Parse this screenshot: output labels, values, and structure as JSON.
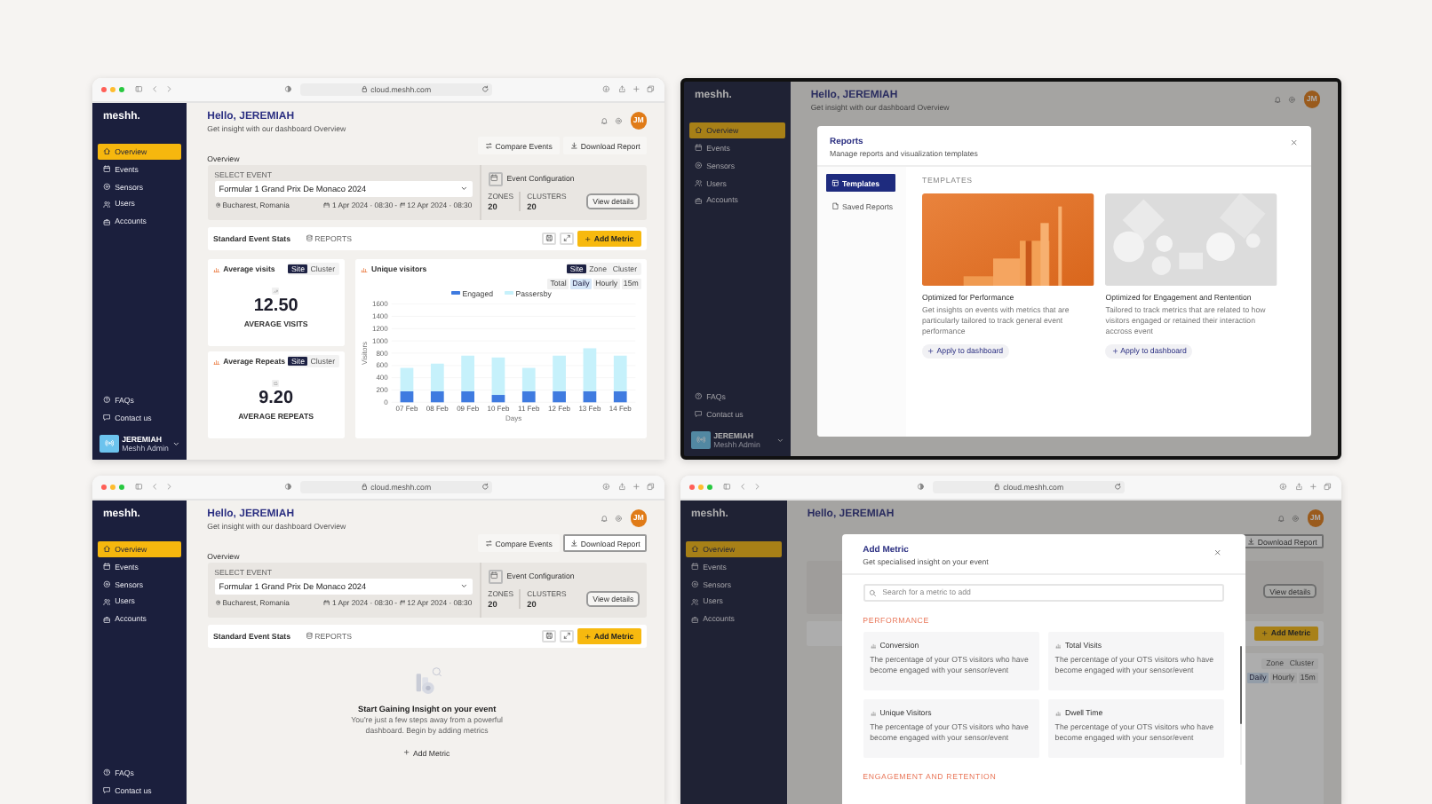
{
  "screens": [
    {
      "browser": {
        "url": "cloud.meshh.com"
      },
      "sidebar": {
        "logo": "meshh.",
        "items": [
          {
            "label": "Overview",
            "selected": true
          },
          {
            "label": "Events",
            "selected": false
          },
          {
            "label": "Sensors",
            "selected": false
          },
          {
            "label": "Users",
            "selected": false
          },
          {
            "label": "Accounts",
            "selected": false
          }
        ],
        "footer_items": [
          {
            "label": "FAQs"
          },
          {
            "label": "Contact us"
          }
        ],
        "user": {
          "name": "JEREMIAH",
          "role": "Meshh Admin"
        }
      },
      "header": {
        "title": "Hello, JEREMIAH",
        "subtitle": "Get insight with our dashboard Overview",
        "avatar": "JM"
      },
      "actions": [
        {
          "label": "Compare Events",
          "kind": "compare",
          "hovered": false
        },
        {
          "label": "Download Report",
          "kind": "download",
          "hovered": false
        }
      ],
      "overview_label": "Overview",
      "event": {
        "select_label": "SELECT EVENT",
        "name": "Formular 1 Grand Prix De Monaco 2024",
        "location": "Bucharest, Romania",
        "start": "1 Apr 2024 · 08:30",
        "date_separator": "-",
        "end": "12 Apr 2024 · 08:30",
        "config_title": "Event Configuration",
        "stats": [
          {
            "label": "ZONES",
            "value": "20"
          },
          {
            "label": "CLUSTERS",
            "value": "20"
          }
        ],
        "details_button": "View details"
      },
      "toolbar": {
        "title": "Standard Event Stats",
        "reports": "REPORTS",
        "add_button": "Add Metric"
      },
      "metrics": [
        {
          "title": "Average visits",
          "toggles": [
            {
              "label": "Site",
              "selected": true
            },
            {
              "label": "Cluster",
              "selected": false
            }
          ],
          "value": "12.50",
          "caption": "AVERAGE VISITS"
        },
        {
          "title": "Average Repeats",
          "toggles": [
            {
              "label": "Site",
              "selected": true
            },
            {
              "label": "Cluster",
              "selected": false
            }
          ],
          "value": "9.20",
          "caption": "AVERAGE REPEATS"
        }
      ],
      "chart_card": {
        "title": "Unique visitors",
        "toggles": [
          {
            "label": "Site",
            "selected": true
          },
          {
            "label": "Zone",
            "selected": false
          },
          {
            "label": "Cluster",
            "selected": false
          }
        ],
        "ranges": [
          {
            "label": "Total",
            "selected": false
          },
          {
            "label": "Daily",
            "selected": true
          },
          {
            "label": "Hourly",
            "selected": false
          },
          {
            "label": "15m",
            "selected": false
          }
        ],
        "chart_data": {
          "type": "bar",
          "stacked": true,
          "grid": true,
          "xlabel": "Days",
          "ylabel": "Visitors",
          "categories": [
            "07 Feb",
            "08 Feb",
            "09 Feb",
            "10 Feb",
            "11 Feb",
            "12 Feb",
            "13 Feb",
            "14 Feb"
          ],
          "series": [
            {
              "name": "Engaged",
              "color": "#3f7be0",
              "values": [
                180,
                180,
                180,
                120,
                180,
                180,
                180,
                180
              ]
            },
            {
              "name": "Passersby",
              "color": "#c6f1fb",
              "values": [
                380,
                450,
                580,
                610,
                380,
                580,
                700,
                580
              ]
            }
          ],
          "ylim": [
            0,
            1600
          ],
          "yticks": [
            0,
            200,
            400,
            600,
            800,
            1000,
            1200,
            1400,
            1600
          ]
        }
      }
    },
    {
      "sidebar": {
        "logo": "meshh.",
        "items": [
          {
            "label": "Overview",
            "selected": true
          },
          {
            "label": "Events",
            "selected": false
          },
          {
            "label": "Sensors",
            "selected": false
          },
          {
            "label": "Users",
            "selected": false
          },
          {
            "label": "Accounts",
            "selected": false
          }
        ],
        "footer_items": [
          {
            "label": "FAQs"
          },
          {
            "label": "Contact us"
          }
        ],
        "user": {
          "name": "JEREMIAH",
          "role": "Meshh Admin"
        }
      },
      "header": {
        "title": "Hello, JEREMIAH",
        "subtitle": "Get insight with our dashboard Overview",
        "avatar": "JM"
      },
      "modal": {
        "kind": "reports",
        "title": "Reports",
        "subtitle": "Manage reports and visualization templates",
        "nav": [
          {
            "label": "Templates",
            "selected": true
          },
          {
            "label": "Saved Reports",
            "selected": false
          }
        ],
        "section": "TEMPLATES",
        "templates": [
          {
            "title": "Optimized for Performance",
            "description": "Get insights on events with metrics that are particularly tailored to track general event performance",
            "button": "Apply to dashboard"
          },
          {
            "title": "Optimized for Engagement and Rentention",
            "description": "Tailored to track metrics that are related to how visitors engaged or retained their interaction accross event",
            "button": "Apply to dashboard"
          }
        ]
      }
    },
    {
      "browser": {
        "url": "cloud.meshh.com"
      },
      "sidebar": {
        "logo": "meshh.",
        "items": [
          {
            "label": "Overview",
            "selected": true
          },
          {
            "label": "Events",
            "selected": false
          },
          {
            "label": "Sensors",
            "selected": false
          },
          {
            "label": "Users",
            "selected": false
          },
          {
            "label": "Accounts",
            "selected": false
          }
        ],
        "footer_items": [
          {
            "label": "FAQs"
          },
          {
            "label": "Contact us"
          }
        ]
      },
      "header": {
        "title": "Hello, JEREMIAH",
        "subtitle": "Get insight with our dashboard Overview",
        "avatar": "JM"
      },
      "actions": [
        {
          "label": "Compare Events",
          "kind": "compare",
          "hovered": false
        },
        {
          "label": "Download Report",
          "kind": "download",
          "hovered": true
        }
      ],
      "overview_label": "Overview",
      "event": {
        "select_label": "SELECT EVENT",
        "name": "Formular 1 Grand Prix De Monaco 2024",
        "location": "Bucharest, Romania",
        "start": "1 Apr 2024 · 08:30",
        "date_separator": "-",
        "end": "12 Apr 2024 · 08:30",
        "config_title": "Event Configuration",
        "stats": [
          {
            "label": "ZONES",
            "value": "20"
          },
          {
            "label": "CLUSTERS",
            "value": "20"
          }
        ],
        "details_button": "View details"
      },
      "toolbar": {
        "title": "Standard Event Stats",
        "reports": "REPORTS",
        "add_button": "Add Metric"
      },
      "empty_state": {
        "title": "Start Gaining Insight on your event",
        "text": "You're just a few steps away from a powerful dashboard. Begin by adding metrics",
        "action": "Add Metric"
      }
    },
    {
      "browser": {
        "url": "cloud.meshh.com"
      },
      "sidebar": {
        "logo": "meshh.",
        "items": [
          {
            "label": "Overview",
            "selected": true
          },
          {
            "label": "Events",
            "selected": false
          },
          {
            "label": "Sensors",
            "selected": false
          },
          {
            "label": "Users",
            "selected": false
          },
          {
            "label": "Accounts",
            "selected": false
          }
        ]
      },
      "header": {
        "title": "Hello, JEREMIAH",
        "avatar": "JM"
      },
      "actions": [
        {
          "label": "Download Report",
          "kind": "download",
          "hovered": true
        }
      ],
      "event": {
        "details_button": "View details"
      },
      "toolbar": {
        "add_button": "Add Metric"
      },
      "chart_card": {
        "toggles": [
          {
            "label": "Zone",
            "selected": false
          },
          {
            "label": "Cluster",
            "selected": false
          }
        ],
        "ranges": [
          {
            "label": "Daily",
            "selected": true
          },
          {
            "label": "Hourly",
            "selected": false
          },
          {
            "label": "15m",
            "selected": false
          }
        ]
      },
      "modal": {
        "kind": "add_metric",
        "title": "Add Metric",
        "subtitle": "Get specialised insight on your event",
        "search_placeholder": "Search for a metric to add",
        "sections": [
          {
            "title": "PERFORMANCE",
            "metrics": [
              {
                "name": "Conversion",
                "description": "The percentage of your OTS visitors who have become engaged with your sensor/event"
              },
              {
                "name": "Total Visits",
                "description": "The percentage of your OTS visitors who have become engaged with your sensor/event"
              },
              {
                "name": "Unique Visitors",
                "description": "The percentage of your OTS visitors who have become engaged with your sensor/event"
              },
              {
                "name": "Dwell Time",
                "description": "The percentage of your OTS visitors who have become engaged with your sensor/event"
              }
            ]
          },
          {
            "title": "ENGAGEMENT AND RETENTION"
          }
        ]
      }
    }
  ]
}
